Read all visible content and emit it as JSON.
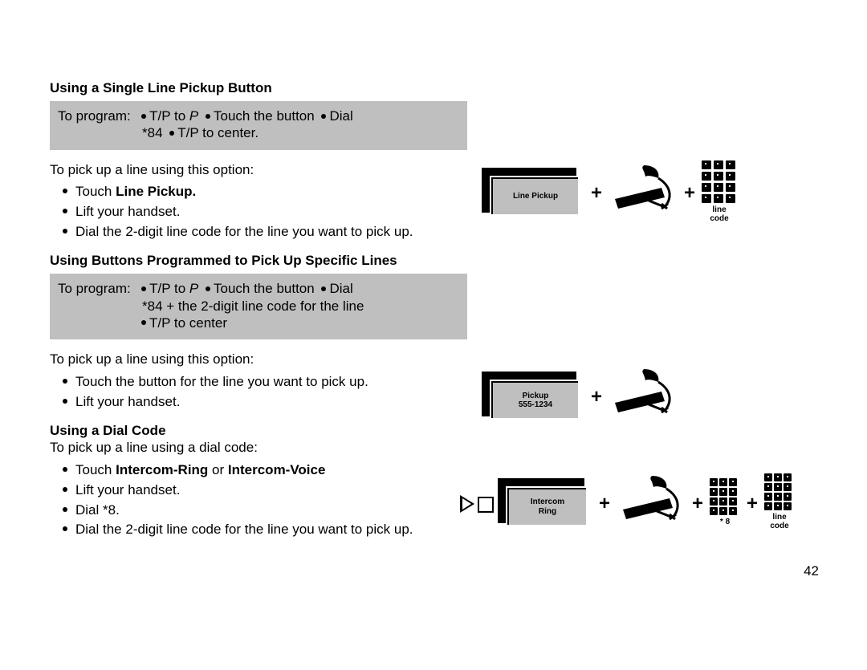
{
  "pageNumber": "42",
  "sec1": {
    "heading": "Using a Single Line Pickup Button",
    "program": {
      "label": "To program:",
      "seg1a": "T/P to ",
      "seg1b_italic": "P",
      "seg2": "Touch the button",
      "seg3": "Dial",
      "line2_a": "*84",
      "line2_b": "T/P  to  center."
    },
    "intro": "To pick up a line using this option:",
    "b1_pre": "Touch ",
    "b1_bold": "Line Pickup.",
    "b2": "Lift your handset.",
    "b3": "Dial the 2-digit line code for the line you want to pick up."
  },
  "sec2": {
    "heading": "Using Buttons Programmed to Pick Up Specific Lines",
    "program": {
      "label": "To  program:",
      "seg1a": "T/P to ",
      "seg1b_italic": "P",
      "seg2": "Touch the button",
      "seg3": "Dial",
      "line2": "*84 + the 2-digit line code for the line",
      "line3": "T/P to center"
    },
    "intro": "To pick up a line using this option:",
    "b1": "Touch the button for the line you want to pick up.",
    "b2": "Lift your handset."
  },
  "sec3": {
    "heading": "Using a Dial Code",
    "intro": "To pick up a line using a dial code:",
    "b1_pre": "Touch ",
    "b1_bold1": "Intercom-Ring",
    "b1_mid": " or ",
    "b1_bold2": "Intercom-Voice",
    "b2": "Lift your handset.",
    "b3": "Dial  *8.",
    "b4": "Dial the 2-digit line code for the line you want to pick up."
  },
  "illus": {
    "btn1": "Line Pickup",
    "btn2a": "Pickup",
    "btn2b": "555-1234",
    "btn3a": "Intercom",
    "btn3b": "Ring",
    "kpLine1": "line",
    "kpLine2": "code",
    "kpStar8": "* 8",
    "plus": "+"
  }
}
